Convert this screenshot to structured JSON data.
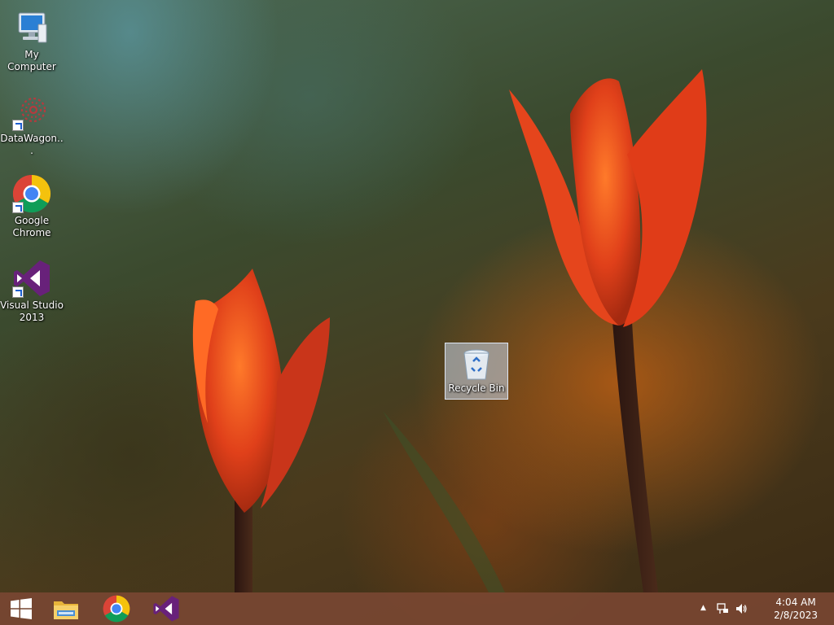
{
  "desktop": {
    "icons": [
      {
        "label": "My Computer",
        "icon": "computer-icon"
      },
      {
        "label": "DataWagon...",
        "icon": "datawagon-icon"
      },
      {
        "label": "Google Chrome",
        "icon": "chrome-icon"
      },
      {
        "label": "Visual Studio 2013",
        "icon": "visual-studio-icon"
      }
    ],
    "recycle_bin": {
      "label": "Recycle Bin",
      "icon": "recycle-bin-icon"
    }
  },
  "taskbar": {
    "pinned": [
      "start-button",
      "file-explorer-icon",
      "chrome-icon",
      "visual-studio-icon"
    ],
    "tray": {
      "show_hidden": "▲",
      "time": "4:04 AM",
      "date": "2/8/2023"
    }
  },
  "colors": {
    "taskbar": "#78463a",
    "chrome_red": "#db4437",
    "chrome_yellow": "#f4c20d",
    "chrome_green": "#0f9d58",
    "chrome_blue": "#4285f4",
    "vs_purple": "#68217a",
    "tulip": "#e8481c"
  }
}
